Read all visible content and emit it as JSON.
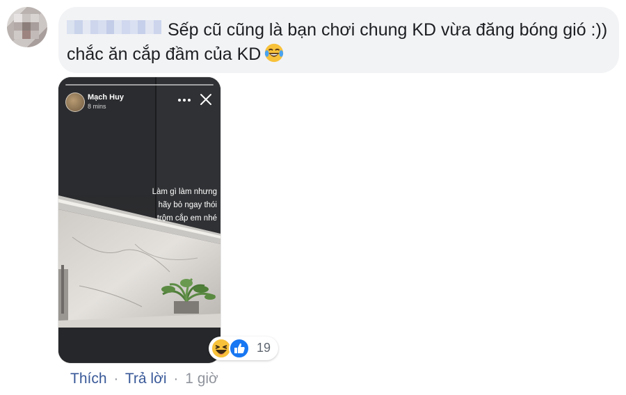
{
  "comment": {
    "text": "Sếp cũ cũng là bạn chơi chung KD vừa đăng bóng gió :)) chắc ăn cắp đầm của KD",
    "emoji": "tears-of-joy-emoji"
  },
  "story": {
    "author": "Mạch Huy",
    "time": "8 mins",
    "caption_lines": [
      "Làm gì làm nhưng",
      "hãy bỏ ngay thói",
      "trộm cắp em nhé"
    ],
    "more_icon": "more-dots-icon",
    "close_icon": "close-icon"
  },
  "reactions": {
    "types": [
      "haha",
      "like"
    ],
    "count": "19"
  },
  "actions": {
    "like": "Thích",
    "reply": "Trả lời",
    "separator": "·",
    "time": "1 giờ"
  },
  "colors": {
    "link": "#385898",
    "meta": "#90949c",
    "bubble": "#f2f3f5",
    "text": "#1c1e21",
    "like_blue": "#1877f2",
    "haha_yellow": "#f7c13a"
  }
}
